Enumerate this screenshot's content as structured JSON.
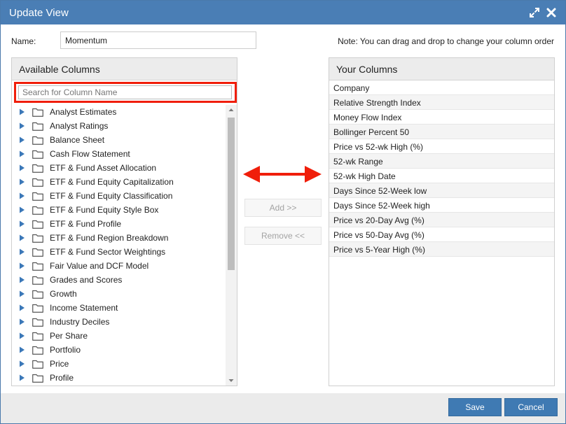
{
  "dialog": {
    "title": "Update View",
    "icons": [
      "expand-icon",
      "close-icon"
    ]
  },
  "name_field": {
    "label": "Name:",
    "value": "Momentum"
  },
  "note": "Note: You can drag and drop to change your column order",
  "available_columns": {
    "header": "Available Columns",
    "search_placeholder": "Search for Column Name",
    "items": [
      "Analyst Estimates",
      "Analyst Ratings",
      "Balance Sheet",
      "Cash Flow Statement",
      "ETF & Fund Asset Allocation",
      "ETF & Fund Equity Capitalization",
      "ETF & Fund Equity Classification",
      "ETF & Fund Equity Style Box",
      "ETF & Fund Profile",
      "ETF & Fund Region Breakdown",
      "ETF & Fund Sector Weightings",
      "Fair Value and DCF Model",
      "Grades and Scores",
      "Growth",
      "Income Statement",
      "Industry Deciles",
      "Per Share",
      "Portfolio",
      "Price",
      "Profile"
    ]
  },
  "actions": {
    "add_label": "Add >>",
    "remove_label": "Remove <<"
  },
  "your_columns": {
    "header": "Your Columns",
    "items": [
      "Company",
      "Relative Strength Index",
      "Money Flow Index",
      "Bollinger Percent 50",
      "Price vs 52-wk High (%)",
      "52-wk Range",
      "52-wk High Date",
      "Days Since 52-Week low",
      "Days Since 52-Week high",
      "Price vs 20-Day Avg (%)",
      "Price vs 50-Day Avg (%)",
      "Price vs 5-Year High (%)"
    ]
  },
  "footer": {
    "save_label": "Save",
    "cancel_label": "Cancel"
  },
  "colors": {
    "titlebar": "#4a7eb5",
    "primary_button": "#3f7ab3",
    "highlight_red": "#f01e0a",
    "tree_arrow": "#3b78b8"
  }
}
